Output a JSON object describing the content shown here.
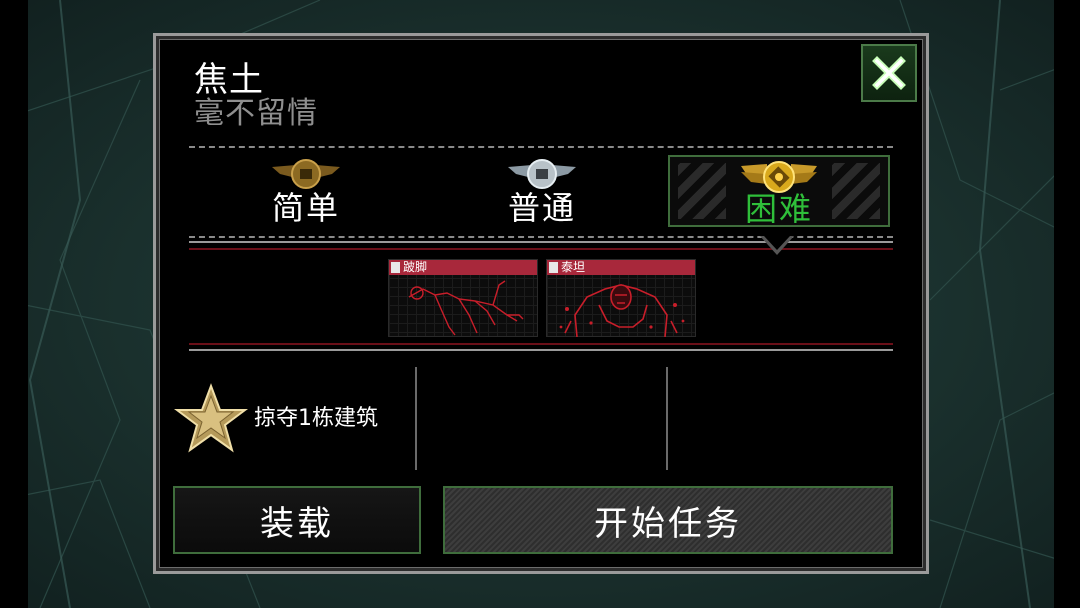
{
  "mission": {
    "title": "焦土",
    "subtitle": "毫不留情"
  },
  "difficulty": {
    "options": [
      {
        "label": "简单",
        "selected": false,
        "emblem": "bronze-coin-wings-icon"
      },
      {
        "label": "普通",
        "selected": false,
        "emblem": "silver-coin-wings-icon"
      },
      {
        "label": "困难",
        "selected": true,
        "emblem": "gold-coin-wings-icon"
      }
    ]
  },
  "enemies": [
    {
      "name": "跛脚",
      "icon": "crawler-zombie-icon"
    },
    {
      "name": "泰坦",
      "icon": "titan-zombie-icon"
    }
  ],
  "objectives": [
    {
      "text": "掠夺1栋建筑",
      "icon": "gold-star-icon"
    }
  ],
  "buttons": {
    "load": "装载",
    "start": "开始任务",
    "close": "close-icon"
  },
  "colors": {
    "selected_label": "#2fbf3a",
    "button_border": "#3f6d3c",
    "enemy_header": "#a8283b",
    "separator_red": "#6a0f18"
  }
}
